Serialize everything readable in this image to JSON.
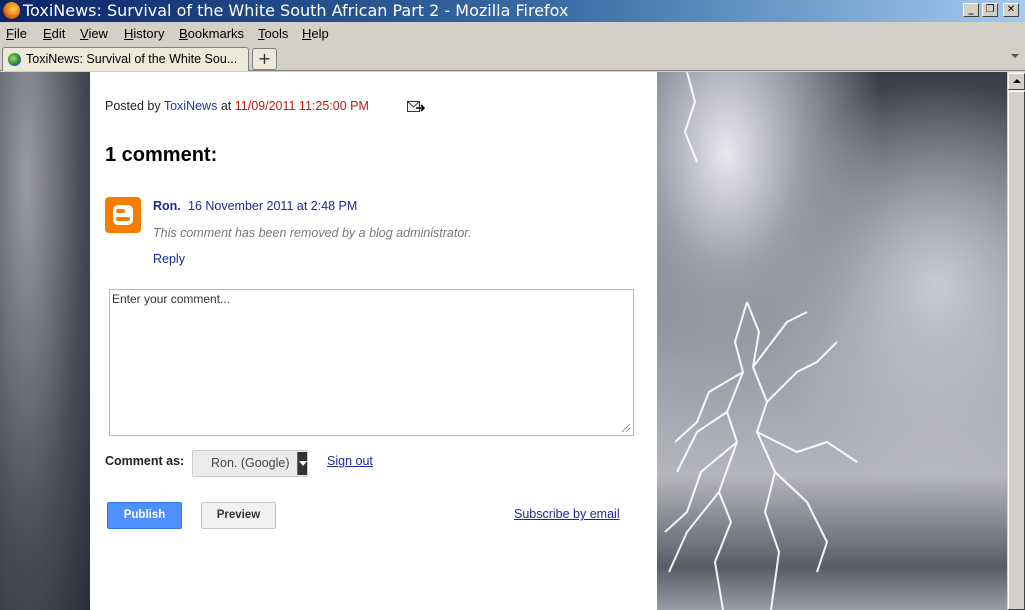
{
  "window": {
    "title": "ToxiNews: Survival of the White South African Part 2 - Mozilla Firefox",
    "minimize": "_",
    "restore": "❐",
    "close": "✕"
  },
  "menu": {
    "items": [
      {
        "label": "File",
        "key": "F",
        "rest": "ile"
      },
      {
        "label": "Edit",
        "key": "E",
        "rest": "dit"
      },
      {
        "label": "View",
        "key": "V",
        "rest": "iew"
      },
      {
        "label": "History",
        "key": "H",
        "rest": "istory"
      },
      {
        "label": "Bookmarks",
        "key": "B",
        "rest": "ookmarks"
      },
      {
        "label": "Tools",
        "key": "T",
        "rest": "ools"
      },
      {
        "label": "Help",
        "key": "H",
        "rest": "elp"
      }
    ]
  },
  "tabs": {
    "active_label": "ToxiNews: Survival of the White Sou...",
    "new_tab": "+"
  },
  "post": {
    "posted_by_prefix": "Posted by",
    "author": "ToxiNews",
    "at": "at",
    "timestamp": "11/09/2011 11:25:00 PM"
  },
  "comments": {
    "heading": "1 comment:",
    "items": [
      {
        "author": "Ron.",
        "date": "16 November 2011 at 2:48 PM",
        "body": "This comment has been removed by a blog administrator.",
        "reply": "Reply"
      }
    ]
  },
  "form": {
    "placeholder": "Enter your comment...",
    "comment_as_label": "Comment as:",
    "identity": "Ron. (Google)",
    "sign_out": "Sign out",
    "publish": "Publish",
    "preview": "Preview",
    "subscribe": "Subscribe by email"
  },
  "colors": {
    "link": "#1a2a9a",
    "timestamp": "#b81b1b",
    "publish_button": "#4d90fe",
    "blogger_avatar": "#f57d00"
  }
}
